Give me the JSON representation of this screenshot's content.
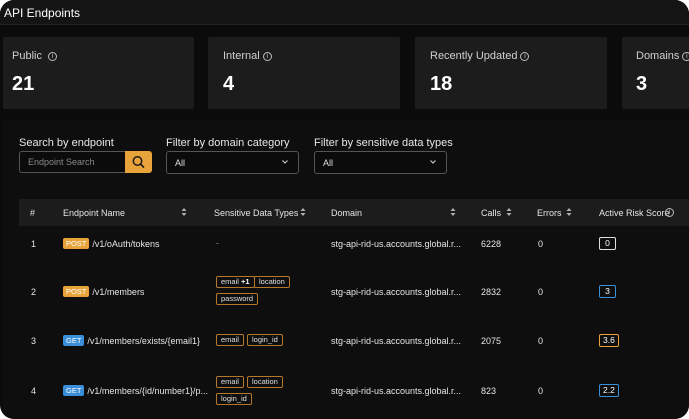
{
  "header": {
    "title": "API Endpoints"
  },
  "stats": [
    {
      "label": "Public",
      "value": "21"
    },
    {
      "label": "Internal",
      "value": "4"
    },
    {
      "label": "Recently Updated",
      "value": "18"
    },
    {
      "label": "Domains",
      "value": "3"
    }
  ],
  "filters": {
    "search_label": "Search by endpoint",
    "search_placeholder": "Endpoint Search",
    "domain_label": "Filter by domain category",
    "domain_value": "All",
    "sensitive_label": "Filter by sensitive data types",
    "sensitive_value": "All"
  },
  "table": {
    "columns": {
      "index": "#",
      "endpoint": "Endpoint Name",
      "sensitive": "Sensitive Data Types",
      "domain": "Domain",
      "calls": "Calls",
      "errors": "Errors",
      "risk": "Active Risk Score"
    },
    "rows": [
      {
        "index": "1",
        "method": "POST",
        "path": "/v1/oAuth/tokens",
        "sensitive_empty": "-",
        "tags": [],
        "domain": "stg-api-rid-us.accounts.global.r...",
        "calls": "6228",
        "errors": "0",
        "risk": "0"
      },
      {
        "index": "2",
        "method": "POST",
        "path": "/v1/members",
        "sensitive_empty": "",
        "tags": [
          "email",
          "location",
          "password"
        ],
        "tag_extra": "+1",
        "domain": "stg-api-rid-us.accounts.global.r...",
        "calls": "2832",
        "errors": "0",
        "risk": "3"
      },
      {
        "index": "3",
        "method": "GET",
        "path": "/v1/members/exists/{email1}",
        "sensitive_empty": "",
        "tags": [
          "email",
          "login_id"
        ],
        "domain": "stg-api-rid-us.accounts.global.r...",
        "calls": "2075",
        "errors": "0",
        "risk": "3.6"
      },
      {
        "index": "4",
        "method": "GET",
        "path": "/v1/members/{id/number1}/p...",
        "sensitive_empty": "",
        "tags": [
          "email",
          "location",
          "login_id"
        ],
        "domain": "stg-api-rid-us.accounts.global.r...",
        "calls": "823",
        "errors": "0",
        "risk": "2.2"
      }
    ]
  },
  "colors": {
    "accent": "#e8a33a",
    "get": "#3b8fd9",
    "card": "#1c1c1c",
    "background": "#0b0b0b"
  },
  "icons": {
    "search": "search-icon",
    "info": "info-icon",
    "chevron": "chevron-down-icon",
    "sort": "sort-icon"
  }
}
